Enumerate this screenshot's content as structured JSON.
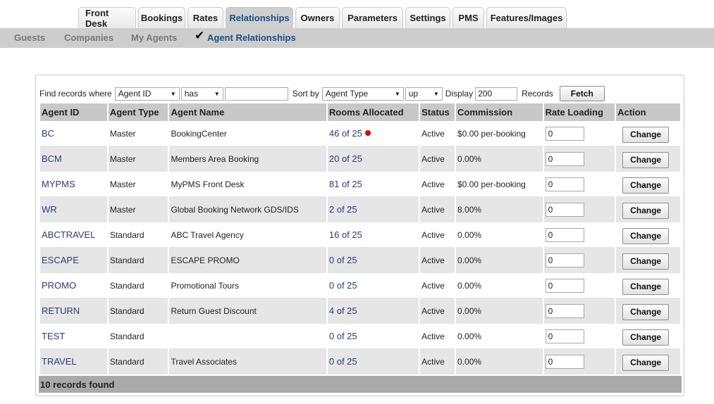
{
  "tabs": [
    "Front Desk",
    "Bookings",
    "Rates",
    "Relationships",
    "Owners",
    "Parameters",
    "Settings",
    "PMS",
    "Features/Images"
  ],
  "active_tab": "Relationships",
  "subnav": {
    "items": [
      "Guests",
      "Companies",
      "My Agents",
      "Agent Relationships"
    ],
    "check_mark": "✔"
  },
  "filters": {
    "find_label": "Find records where",
    "field_select": "Agent ID",
    "op_select": "has",
    "query_value": "",
    "sort_label": "Sort by",
    "sort_select": "Agent Type",
    "order_select": "up",
    "display_label": "Display",
    "display_value": "200",
    "records_label": "Records",
    "fetch_label": "Fetch"
  },
  "table": {
    "headers": [
      "Agent ID",
      "Agent Type",
      "Agent Name",
      "Rooms Allocated",
      "Status",
      "Commission",
      "Rate Loading",
      "Action"
    ],
    "rows": [
      {
        "id": "BC",
        "type": "Master",
        "name": "BookingCenter",
        "rooms": "46 of 25",
        "alert": true,
        "status": "Active",
        "commission": "$0.00 per-booking",
        "rate": "0",
        "action": "Change"
      },
      {
        "id": "BCM",
        "type": "Master",
        "name": "Members Area Booking",
        "rooms": "20 of 25",
        "alert": false,
        "status": "Active",
        "commission": "0.00%",
        "rate": "0",
        "action": "Change"
      },
      {
        "id": "MYPMS",
        "type": "Master",
        "name": "MyPMS Front Desk",
        "rooms": "81 of 25",
        "alert": false,
        "status": "Active",
        "commission": "$0.00 per-booking",
        "rate": "0",
        "action": "Change"
      },
      {
        "id": "WR",
        "type": "Master",
        "name": "Global Booking Network GDS/IDS",
        "rooms": "2 of 25",
        "alert": false,
        "status": "Active",
        "commission": "8.00%",
        "rate": "0",
        "action": "Change"
      },
      {
        "id": "ABCTRAVEL",
        "type": "Standard",
        "name": "ABC Travel Agency",
        "rooms": "16 of 25",
        "alert": false,
        "status": "Active",
        "commission": "0.00%",
        "rate": "0",
        "action": "Change"
      },
      {
        "id": "ESCAPE",
        "type": "Standard",
        "name": "ESCAPE PROMO",
        "rooms": "0 of 25",
        "alert": false,
        "status": "Active",
        "commission": "0.00%",
        "rate": "0",
        "action": "Change"
      },
      {
        "id": "PROMO",
        "type": "Standard",
        "name": "Promotional Tours",
        "rooms": "0 of 25",
        "alert": false,
        "status": "Active",
        "commission": "0.00%",
        "rate": "0",
        "action": "Change"
      },
      {
        "id": "RETURN",
        "type": "Standard",
        "name": "Return Guest Discount",
        "rooms": "4 of 25",
        "alert": false,
        "status": "Active",
        "commission": "0.00%",
        "rate": "0",
        "action": "Change"
      },
      {
        "id": "TEST",
        "type": "Standard",
        "name": "",
        "rooms": "0 of 25",
        "alert": false,
        "status": "Active",
        "commission": "0.00%",
        "rate": "0",
        "action": "Change"
      },
      {
        "id": "TRAVEL",
        "type": "Standard",
        "name": "Travel Associates",
        "rooms": "0 of 25",
        "alert": false,
        "status": "Active",
        "commission": "0.00%",
        "rate": "0",
        "action": "Change"
      }
    ]
  },
  "footer": "10 records found",
  "colors": {
    "link": "#2c3d7a",
    "active_tab_text": "#1c4f82",
    "alert_dot": "#e00000"
  }
}
